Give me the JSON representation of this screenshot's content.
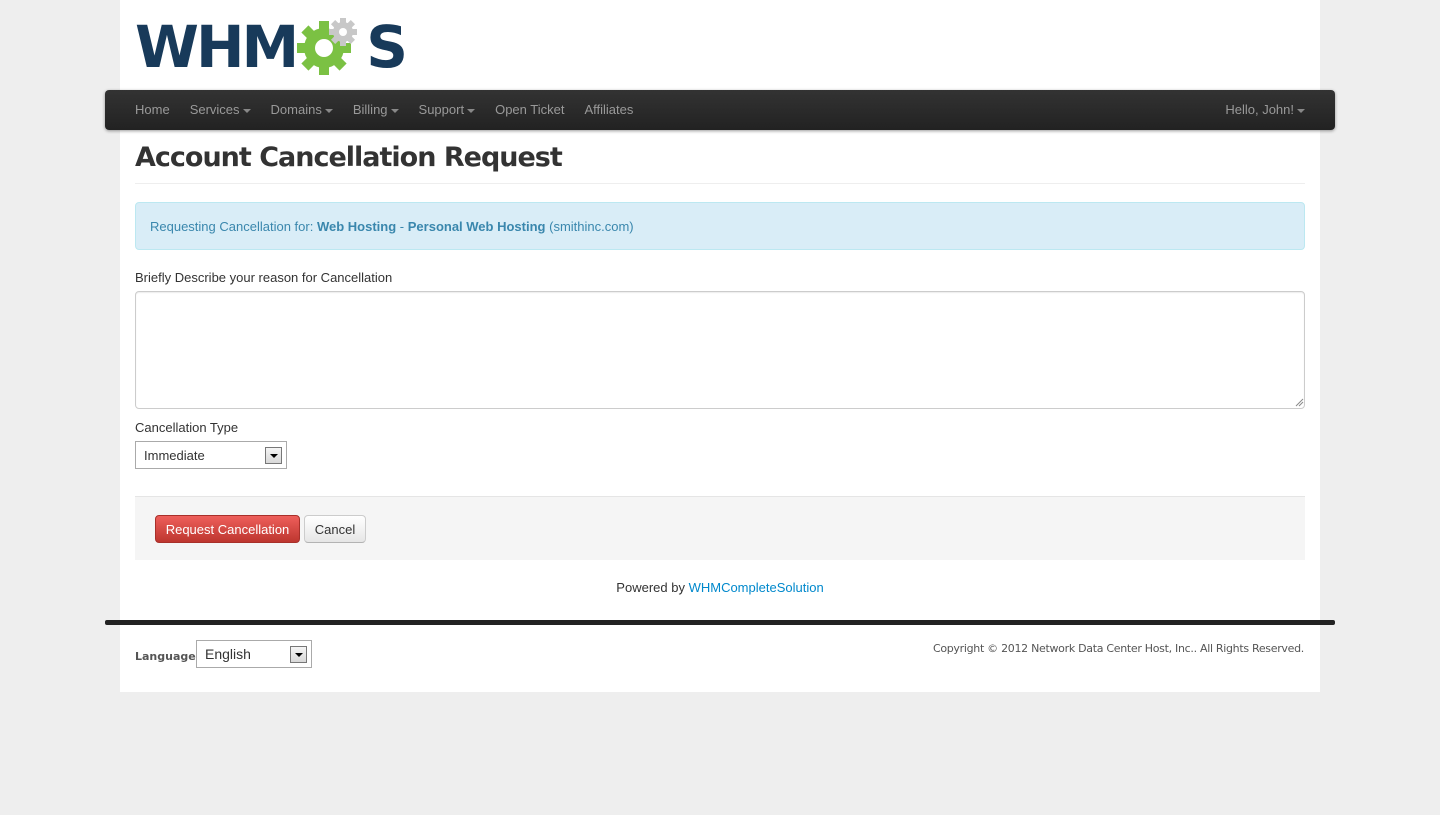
{
  "brand": {
    "logo_text_left": "WHM",
    "logo_text_right": "S",
    "logo_accent": "#7bc143",
    "logo_color": "#183a5a"
  },
  "nav": {
    "items": [
      {
        "label": "Home",
        "dropdown": false
      },
      {
        "label": "Services",
        "dropdown": true
      },
      {
        "label": "Domains",
        "dropdown": true
      },
      {
        "label": "Billing",
        "dropdown": true
      },
      {
        "label": "Support",
        "dropdown": true
      },
      {
        "label": "Open Ticket",
        "dropdown": false
      },
      {
        "label": "Affiliates",
        "dropdown": false
      }
    ],
    "user_menu": "Hello, John!"
  },
  "page": {
    "title": "Account Cancellation Request",
    "alert": {
      "prefix": "Requesting Cancellation for:",
      "product": "Web Hosting",
      "separator": "-",
      "plan": "Personal Web Hosting",
      "domain": "(smithinc.com)"
    },
    "form": {
      "reason_label": "Briefly Describe your reason for Cancellation",
      "reason_value": "",
      "type_label": "Cancellation Type",
      "type_selected": "Immediate"
    },
    "buttons": {
      "submit": "Request Cancellation",
      "cancel": "Cancel"
    }
  },
  "footer": {
    "powered_prefix": "Powered by",
    "powered_link": "WHMCompleteSolution",
    "language_label": "Language:",
    "language_selected": "English",
    "copyright": "Copyright © 2012 Network Data Center Host, Inc.. All Rights Reserved."
  },
  "colors": {
    "navbar": "#222222",
    "alert_bg": "#d9edf7",
    "alert_text": "#3a87ad",
    "danger": "#da4f49",
    "link": "#0088cc"
  }
}
